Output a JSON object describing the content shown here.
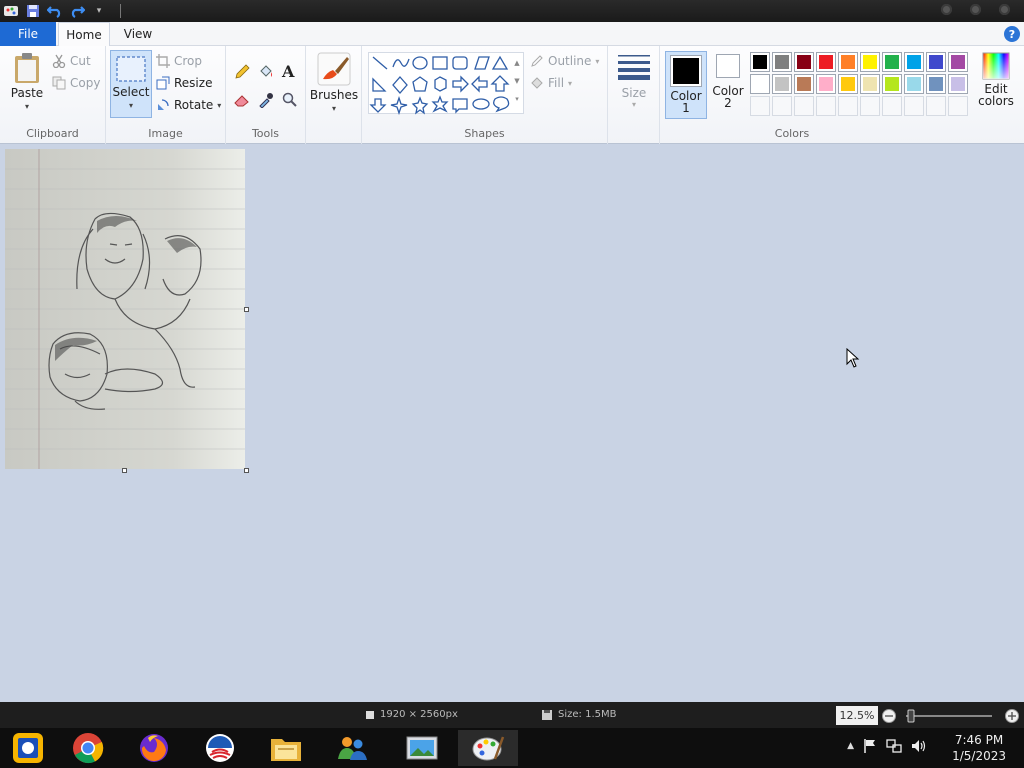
{
  "tabs": {
    "file": "File",
    "home": "Home",
    "view": "View"
  },
  "clipboard": {
    "paste": "Paste",
    "cut": "Cut",
    "copy": "Copy",
    "label": "Clipboard"
  },
  "image_group": {
    "select": "Select",
    "crop": "Crop",
    "resize": "Resize",
    "rotate": "Rotate",
    "label": "Image"
  },
  "tools_group": {
    "label": "Tools"
  },
  "brushes": {
    "label": "Brushes"
  },
  "shapes_group": {
    "outline": "Outline",
    "fill": "Fill",
    "label": "Shapes"
  },
  "size": {
    "label": "Size"
  },
  "color1": {
    "label_line1": "Color",
    "label_line2": "1",
    "value": "#000000"
  },
  "color2": {
    "label_line1": "Color",
    "label_line2": "2",
    "value": "#ffffff"
  },
  "edit_colors": {
    "line1": "Edit",
    "line2": "colors"
  },
  "colors_group": {
    "label": "Colors"
  },
  "palette_row1": [
    "#000000",
    "#7f7f7f",
    "#880015",
    "#ed1c24",
    "#ff7f27",
    "#fff200",
    "#22b14c",
    "#00a2e8",
    "#3f48cc",
    "#a349a4"
  ],
  "palette_row2": [
    "#ffffff",
    "#c3c3c3",
    "#b97a57",
    "#ffaec9",
    "#ffc90e",
    "#efe4b0",
    "#b5e61d",
    "#99d9ea",
    "#7092be",
    "#c8bfe7"
  ],
  "status": {
    "dimensions": "1920 × 2560px",
    "size": "Size: 1.5MB",
    "zoom": "12.5%"
  },
  "clock": {
    "time": "7:46 PM",
    "date": "1/5/2023"
  },
  "taskbar_apps": [
    "Chrome",
    "Firefox",
    "Obama logo",
    "File Explorer",
    "Windows Live",
    "Photo Viewer",
    "Paint"
  ]
}
